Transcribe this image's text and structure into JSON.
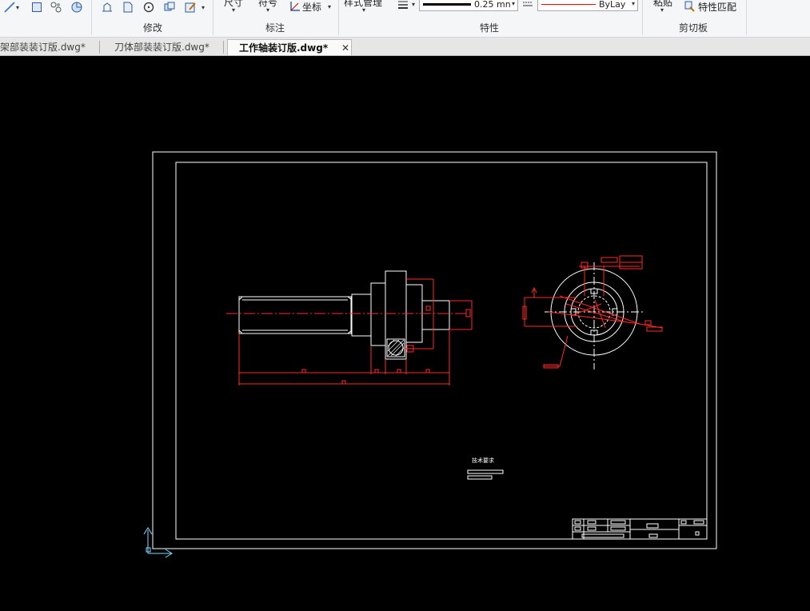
{
  "ribbon": {
    "groups": [
      {
        "id": "modify",
        "label": "修改"
      },
      {
        "id": "annotate",
        "label": "标注"
      },
      {
        "id": "properties",
        "label": "特性"
      },
      {
        "id": "clipboard",
        "label": "剪切板"
      }
    ],
    "dimension_label": "尺寸",
    "symbol_label": "符号",
    "coordinate_label": "坐标",
    "style_manager_label": "样式管理",
    "lineweight_value": "0.25 mn",
    "linetype_value": "ByLay",
    "paste_label": "粘贴",
    "match_properties_label": "特性匹配"
  },
  "tabs": [
    {
      "label": "架部装装订版.dwg*",
      "active": false
    },
    {
      "label": "刀体部装装订版.dwg*",
      "active": false
    },
    {
      "label": "工作轴装订版.dwg*",
      "active": true
    }
  ],
  "drawing": {
    "note_text": "技术要求",
    "colors": {
      "frame": "#ffffff",
      "geometry": "#ffffff",
      "dimension": "#ff2a2a",
      "ucs": "#7fdcff"
    }
  }
}
